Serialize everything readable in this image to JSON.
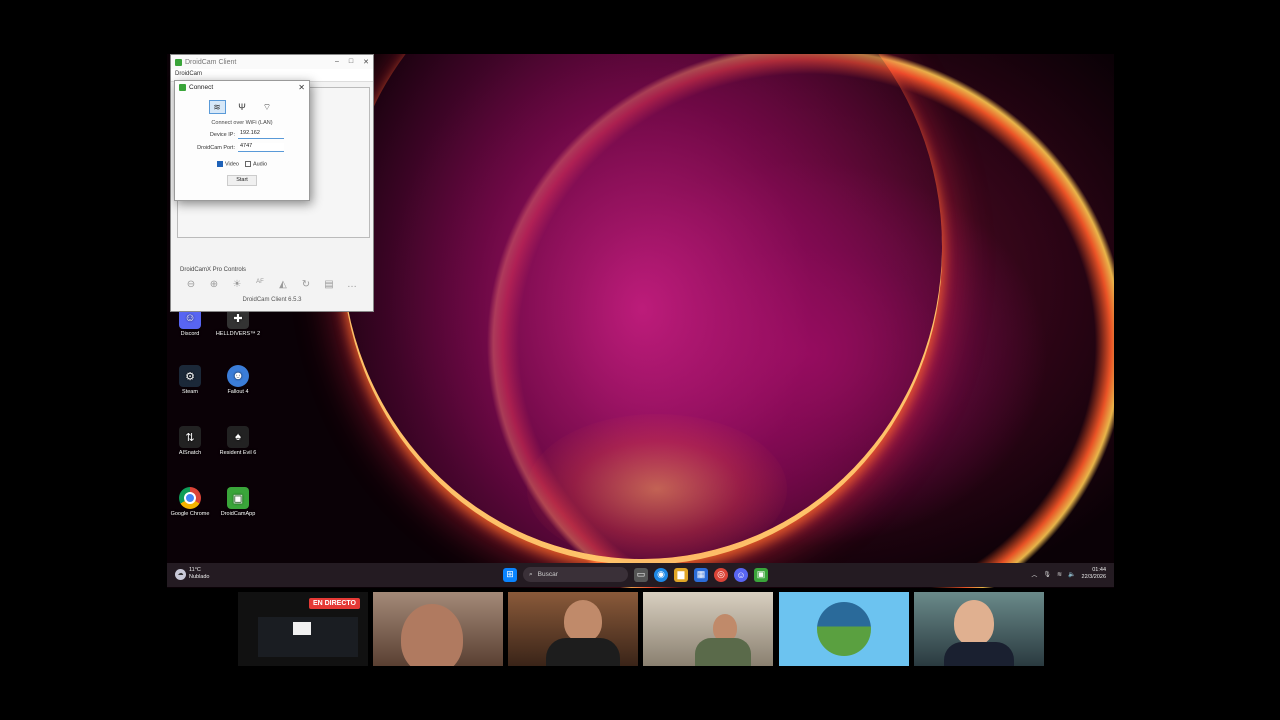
{
  "window": {
    "title": "DroidCam Client",
    "menu": "DroidCam",
    "pro_controls_label": "DroidCamX Pro Controls",
    "footer": "DroidCam Client 6.5.3"
  },
  "dialog": {
    "title": "Connect",
    "caption": "Connect over WiFi (LAN)",
    "device_ip_label": "Device IP:",
    "device_ip_value": "192.162",
    "port_label": "DroidCam Port:",
    "port_value": "4747",
    "video_label": "Video",
    "audio_label": "Audio",
    "video_checked": true,
    "audio_checked": false,
    "start_label": "Start"
  },
  "desktop_icons": [
    {
      "label": "Discord",
      "icon": "discord-icon",
      "color": "#5865f2"
    },
    {
      "label": "HELLDIVERS™ 2",
      "icon": "helldivers-icon",
      "color": "#333333"
    },
    {
      "label": "Steam",
      "icon": "steam-icon",
      "color": "#1b2838"
    },
    {
      "label": "Fallout 4",
      "icon": "fallout-icon",
      "color": "#3b7dd8"
    },
    {
      "label": "AISnatch",
      "icon": "aisnatch-icon",
      "color": "#222222"
    },
    {
      "label": "Resident Evil 6",
      "icon": "resident-evil-icon",
      "color": "#222222"
    },
    {
      "label": "Google Chrome",
      "icon": "chrome-icon",
      "color": "#db4437"
    },
    {
      "label": "DroidCamApp",
      "icon": "droidcam-icon",
      "color": "#3aa53a"
    }
  ],
  "taskbar": {
    "weather_temp": "11°C",
    "weather_desc": "Nublado",
    "search_placeholder": "Buscar",
    "time": "01:44",
    "date": "22/3/2026"
  },
  "stream": {
    "live_badge": "EN DIRECTO"
  }
}
